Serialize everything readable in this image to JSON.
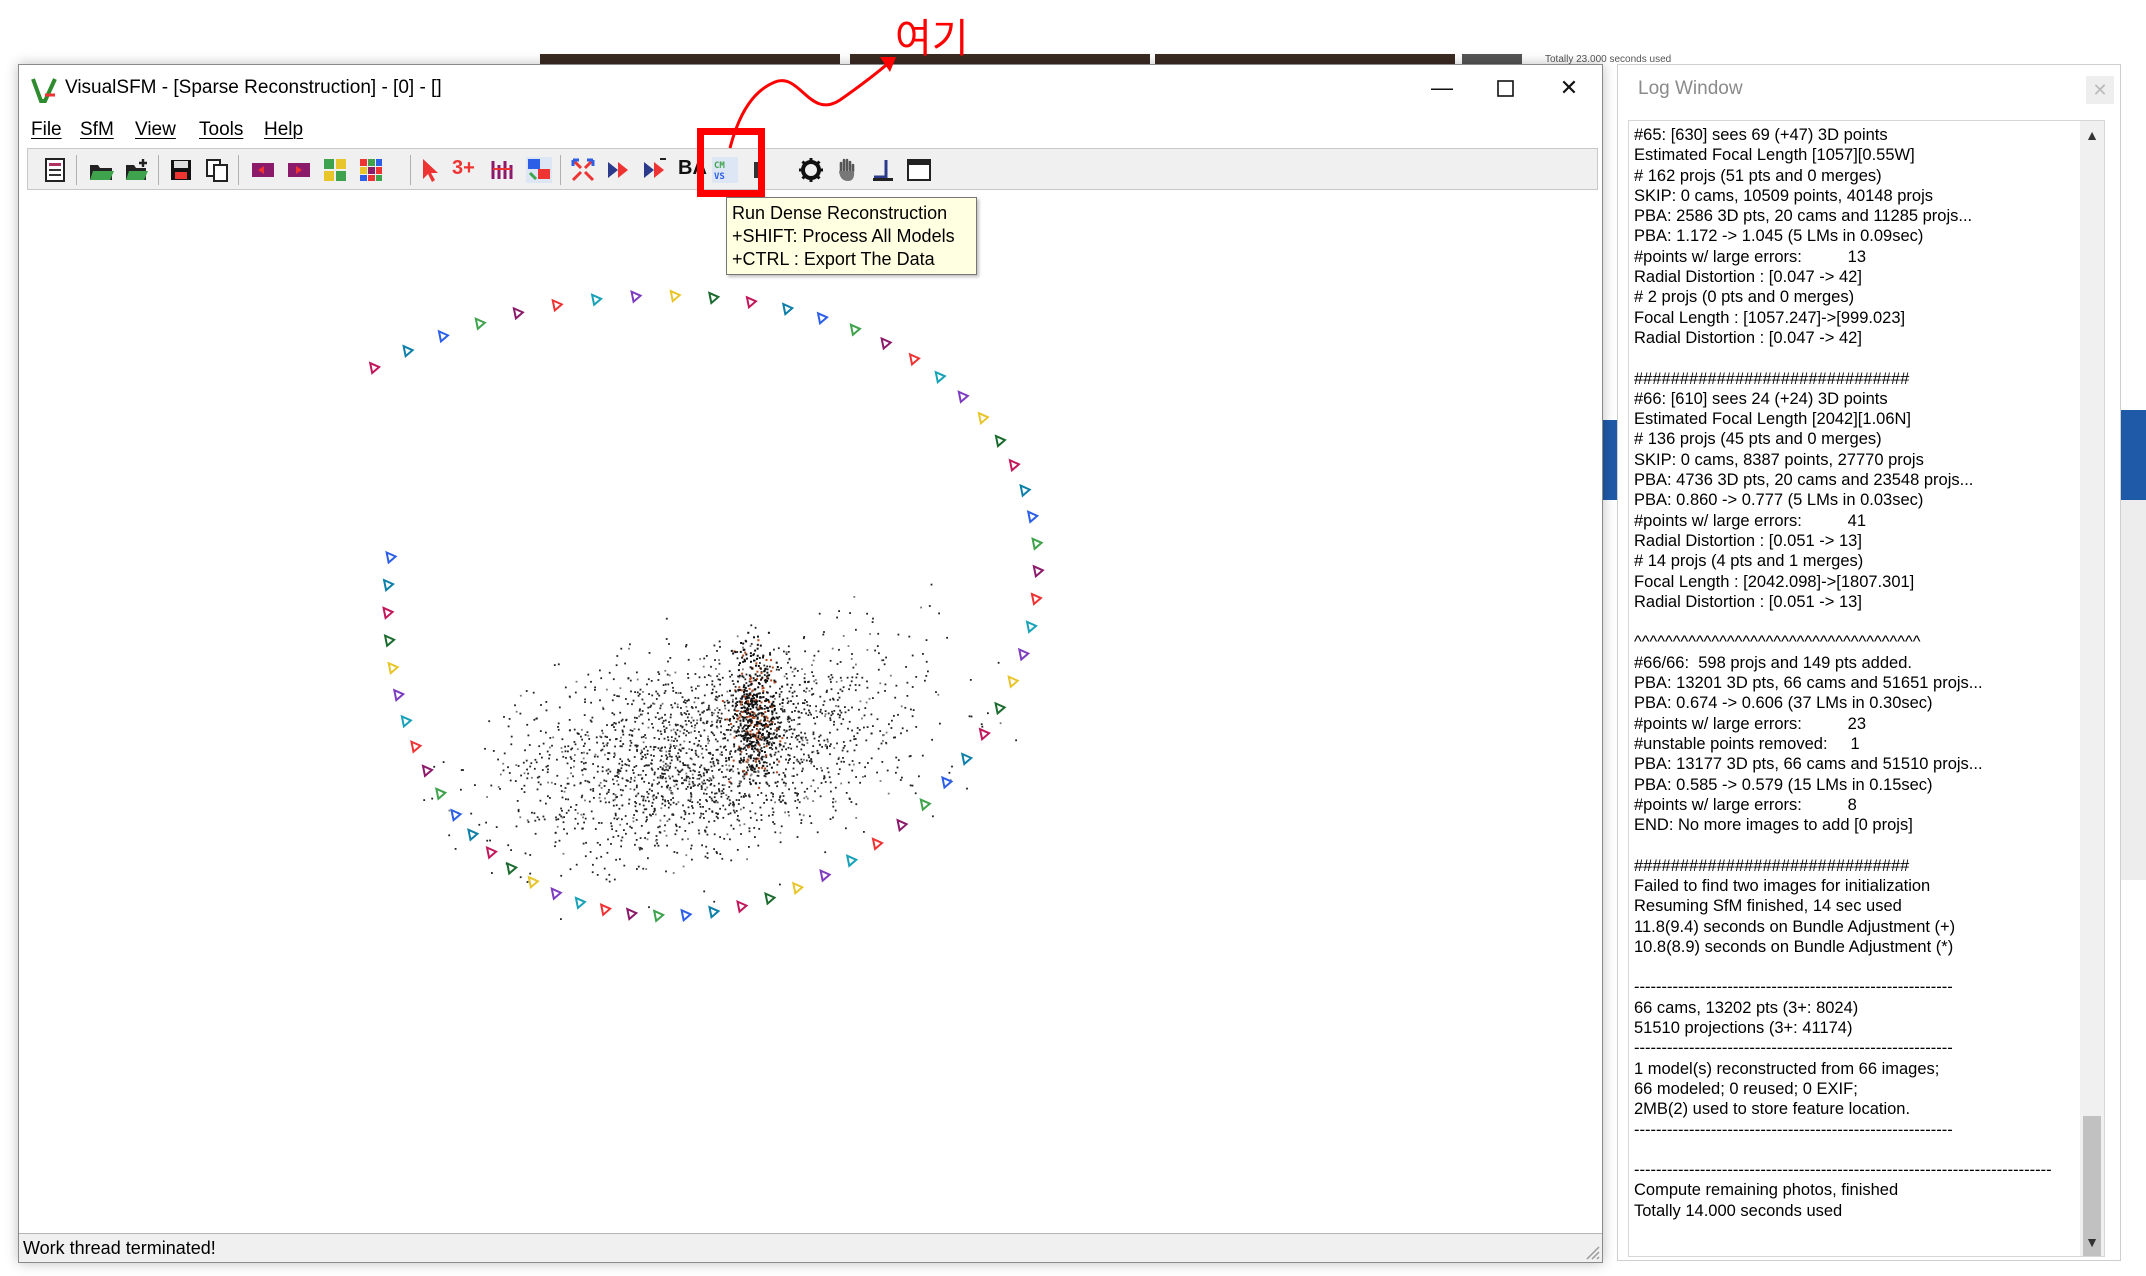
{
  "annotation": {
    "label": "여기",
    "color": "#ff0000"
  },
  "background": {
    "snippet": "Totally 23.000 seconds used"
  },
  "main_window": {
    "title": "VisualSFM - [Sparse Reconstruction] - [0] - []",
    "menu": [
      "File",
      "SfM",
      "View",
      "Tools",
      "Help"
    ],
    "toolbar_text": {
      "three_plus": "3+",
      "ba": "BA"
    },
    "toolbar_icons": [
      "log-window-icon",
      "open-folder-icon",
      "add-images-icon",
      "save-icon",
      "copy-icon",
      "match-icon-1",
      "match-icon-2",
      "zoom-3d-icon",
      "color-grid-icon",
      "pointer-icon",
      "three-plus-icon",
      "feature-icon",
      "swap-icon",
      "expand-icon",
      "reconstruct-icon",
      "reconstruct-resume-icon",
      "bundle-adjust-icon",
      "dense-reconstruction-icon",
      "settings-gear-icon",
      "hand-icon",
      "corner-icon",
      "window-icon"
    ],
    "tooltip": [
      "Run Dense Reconstruction",
      "+SHIFT: Process All Models",
      "+CTRL : Export The Data"
    ],
    "status": "Work thread terminated!"
  },
  "log_window": {
    "title": "Log Window",
    "lines": [
      "#65: [630] sees 69 (+47) 3D points",
      "Estimated Focal Length [1057][0.55W]",
      "# 162 projs (51 pts and 0 merges)",
      "SKIP: 0 cams, 10509 points, 40148 projs",
      "PBA: 2586 3D pts, 20 cams and 11285 projs...",
      "PBA: 1.172 -> 1.045 (5 LMs in 0.09sec)",
      "#points w/ large errors:          13",
      "Radial Distortion : [0.047 -> 42]",
      "# 2 projs (0 pts and 0 merges)",
      "Focal Length : [1057.247]->[999.023]",
      "Radial Distortion : [0.047 -> 42]",
      "",
      "##############################",
      "#66: [610] sees 24 (+24) 3D points",
      "Estimated Focal Length [2042][1.06N]",
      "# 136 projs (45 pts and 0 merges)",
      "SKIP: 0 cams, 8387 points, 27770 projs",
      "PBA: 4736 3D pts, 20 cams and 23548 projs...",
      "PBA: 0.860 -> 0.777 (5 LMs in 0.03sec)",
      "#points w/ large errors:          41",
      "Radial Distortion : [0.051 -> 13]",
      "# 14 projs (4 pts and 1 merges)",
      "Focal Length : [2042.098]->[1807.301]",
      "Radial Distortion : [0.051 -> 13]",
      "",
      "^^^^^^^^^^^^^^^^^^^^^^^^^^^^^^^^^^^^^",
      "#66/66:  598 projs and 149 pts added.",
      "PBA: 13201 3D pts, 66 cams and 51651 projs...",
      "PBA: 0.674 -> 0.606 (37 LMs in 0.30sec)",
      "#points w/ large errors:          23",
      "#unstable points removed:     1",
      "PBA: 13177 3D pts, 66 cams and 51510 projs...",
      "PBA: 0.585 -> 0.579 (15 LMs in 0.15sec)",
      "#points w/ large errors:          8",
      "END: No more images to add [0 projs]",
      "",
      "##############################",
      "Failed to find two images for initialization",
      "Resuming SfM finished, 14 sec used",
      "11.8(9.4) seconds on Bundle Adjustment (+)",
      "10.8(8.9) seconds on Bundle Adjustment (*)",
      "",
      "----------------------------------------------------------",
      "66 cams, 13202 pts (3+: 8024)",
      "51510 projections (3+: 41174)",
      "----------------------------------------------------------",
      "1 model(s) reconstructed from 66 images;",
      "66 modeled; 0 reused; 0 EXIF;",
      "2MB(2) used to store feature location.",
      "----------------------------------------------------------",
      "",
      "----------------------------------------------------------------------------",
      "Compute remaining photos, finished",
      "Totally 14.000 seconds used"
    ]
  }
}
